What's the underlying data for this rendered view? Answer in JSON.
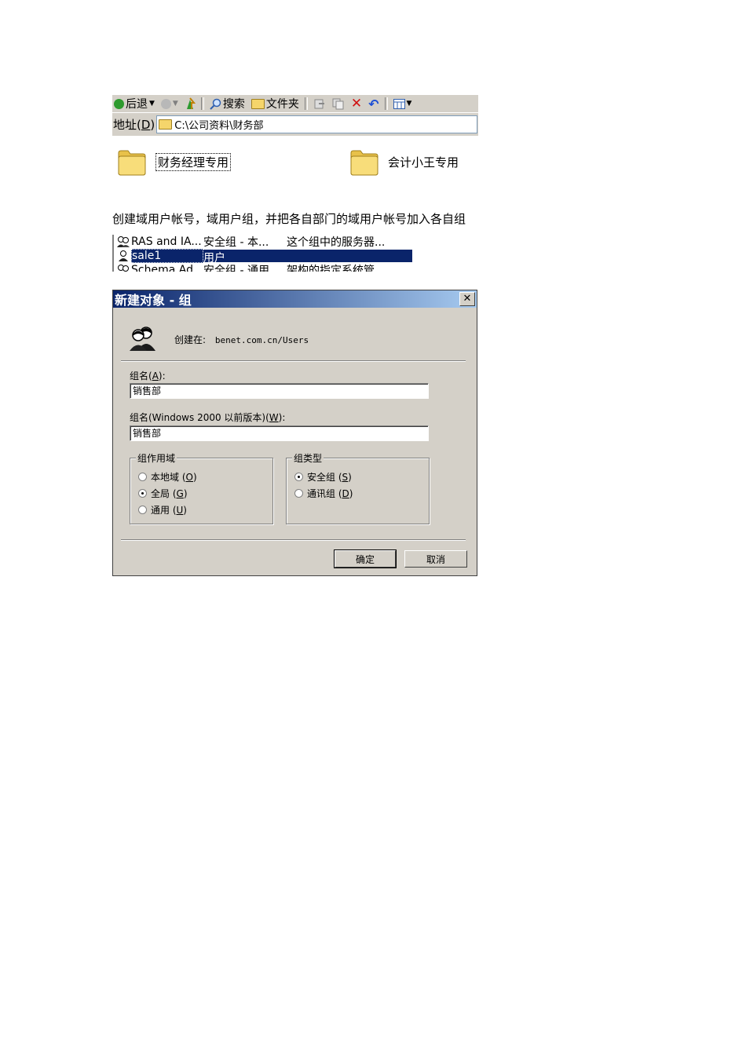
{
  "explorer": {
    "toolbar": {
      "back_label": "后退",
      "search_label": "搜索",
      "folders_label": "文件夹"
    },
    "address": {
      "label": "地址(",
      "label_key": "D",
      "label_close": ")",
      "path": "C:\\公司资料\\财务部"
    },
    "folders": [
      {
        "name": "财务经理专用"
      },
      {
        "name": "会计小王专用"
      }
    ]
  },
  "instruction": "创建域用户帐号，域用户组，并把各自部门的域用户帐号加入各自组",
  "group_list": {
    "rows": [
      {
        "name": "RAS and IA...",
        "type": "安全组 - 本...",
        "desc": "这个组中的服务器..."
      },
      {
        "name": "sale1",
        "type": "用户",
        "desc": ""
      },
      {
        "name": "Schema Ad...",
        "type": "安全组 - 通用",
        "desc": "架构的指定系统管"
      }
    ]
  },
  "dialog": {
    "title": "新建对象 - 组",
    "close_glyph": "✕",
    "created_in_label": "创建在:",
    "created_in_path": "benet.com.cn/Users",
    "group_name_label": "组名(",
    "group_name_key": "A",
    "group_name_label_close": "):",
    "group_name_value": "销售部",
    "group_name_pre2000_label": "组名(Windows 2000 以前版本)(",
    "group_name_pre2000_key": "W",
    "group_name_pre2000_label_close": "):",
    "group_name_pre2000_value": "销售部",
    "scope": {
      "title": "组作用域",
      "options": [
        {
          "label": "本地域 (",
          "key": "O",
          "close": ")",
          "selected": false
        },
        {
          "label": "全局 (",
          "key": "G",
          "close": ")",
          "selected": true
        },
        {
          "label": "通用 (",
          "key": "U",
          "close": ")",
          "selected": false
        }
      ]
    },
    "type": {
      "title": "组类型",
      "options": [
        {
          "label": "安全组 (",
          "key": "S",
          "close": ")",
          "selected": true
        },
        {
          "label": "通讯组 (",
          "key": "D",
          "close": ")",
          "selected": false
        }
      ]
    },
    "ok_label": "确定",
    "cancel_label": "取消"
  },
  "colors": {
    "selection": "#0a246a",
    "dialog_bg": "#d4d0c8",
    "title_gradient_end": "#a6caf0"
  }
}
